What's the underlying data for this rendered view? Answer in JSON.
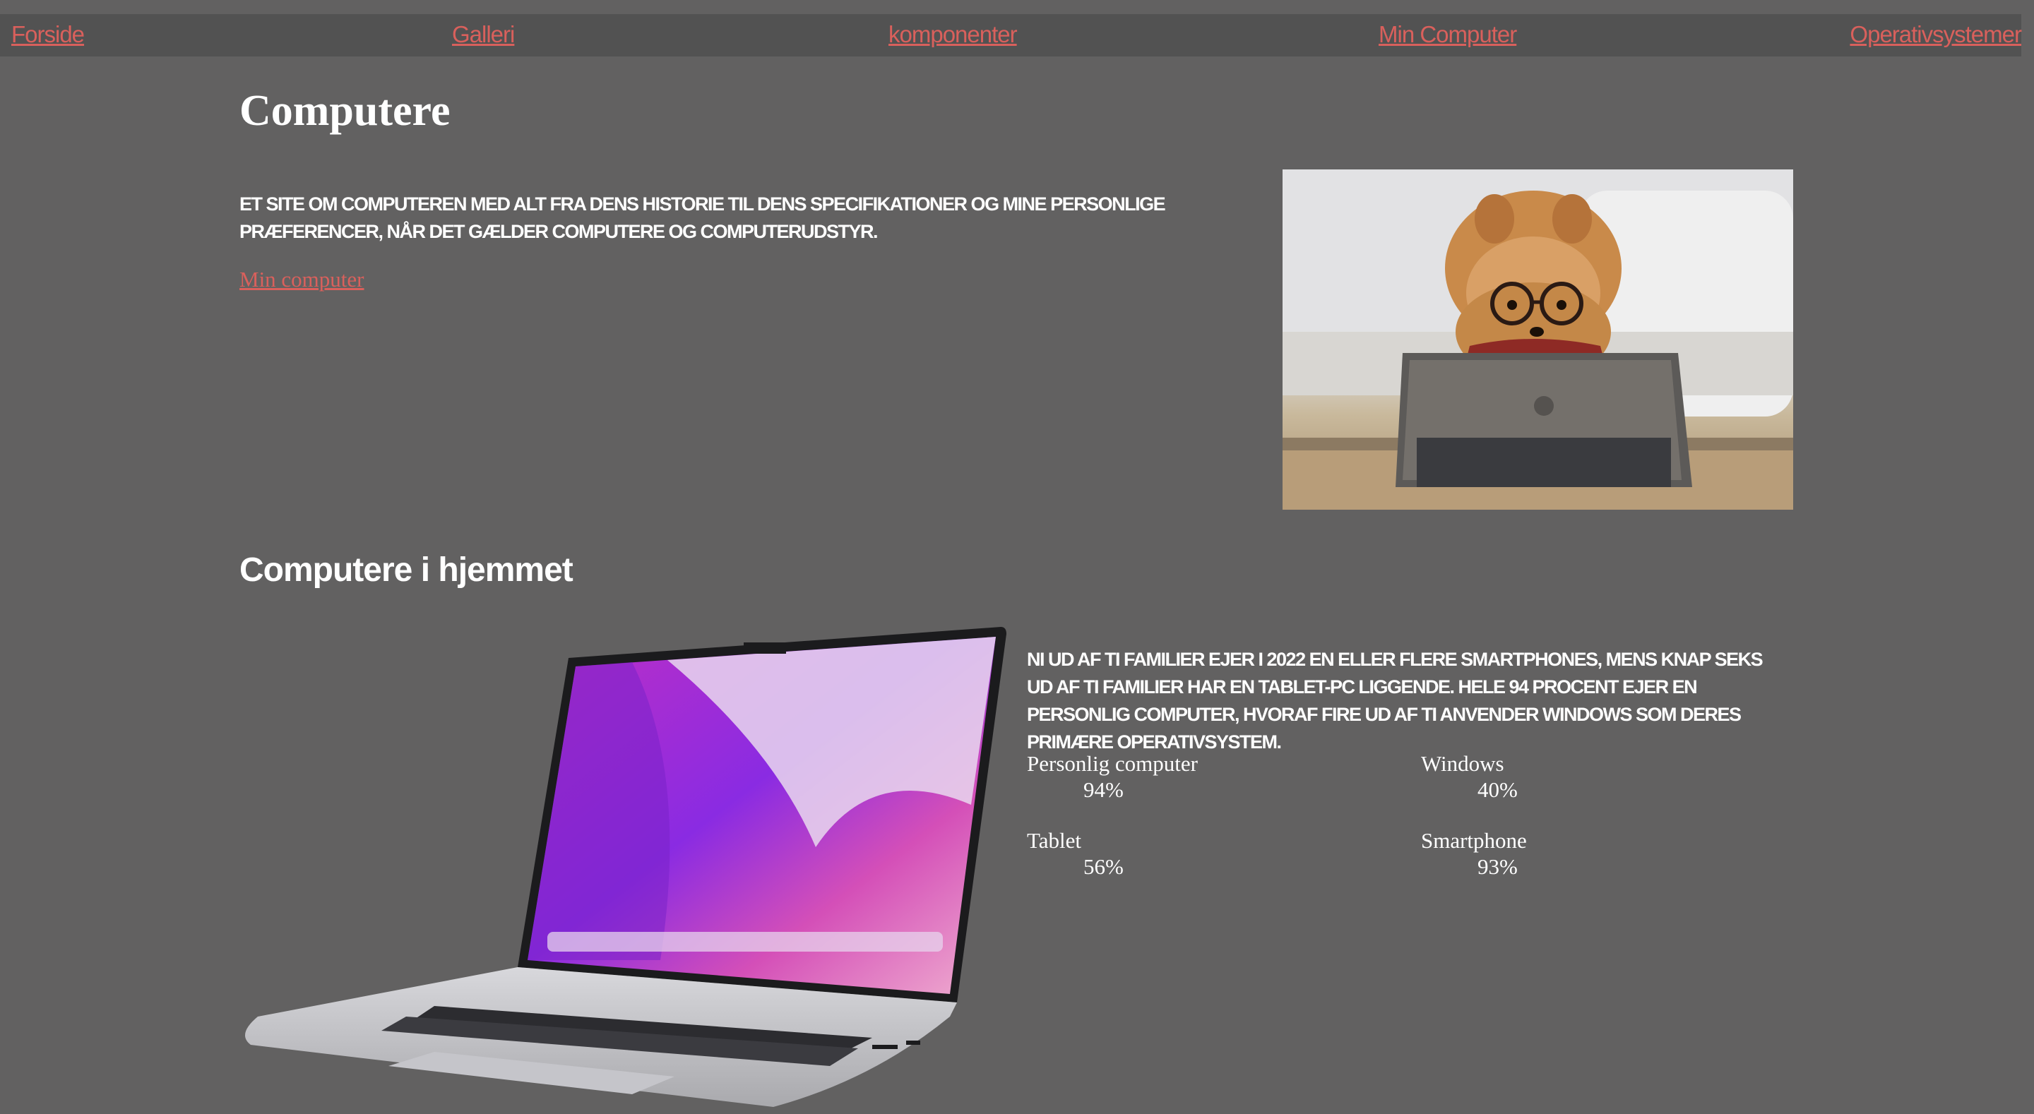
{
  "nav": {
    "items": [
      {
        "label": "Forside"
      },
      {
        "label": "Galleri"
      },
      {
        "label": "komponenter"
      },
      {
        "label": "Min Computer"
      },
      {
        "label": "Operativsystemer"
      }
    ]
  },
  "hero": {
    "title": "Computere",
    "intro": "Et site om computeren med alt fra dens historie til dens specifikationer og mine personlige præferencer, når det gælder computere og computerudstyr.",
    "link_label": "Min computer",
    "image_icon": "dog-with-glasses-tablet-photo"
  },
  "home_section": {
    "title": "Computere i hjemmet",
    "text": "Ni ud af ti familier ejer i 2022 en eller flere smartphones, mens knap seks ud af ti familier har en tablet-pc liggende. Hele 94 procent ejer en personlig computer, hvoraf fire ud af ti anvender Windows som deres primære operativsystem.",
    "image_icon": "laptop-photo",
    "stats": [
      {
        "label": "Personlig computer",
        "value": "94%"
      },
      {
        "label": "Windows",
        "value": "40%"
      },
      {
        "label": "Tablet",
        "value": "56%"
      },
      {
        "label": "Smartphone",
        "value": "93%"
      }
    ]
  },
  "colors": {
    "background": "#626161",
    "navbar": "#525252",
    "link": "#d9605c",
    "text": "#ffffff"
  }
}
